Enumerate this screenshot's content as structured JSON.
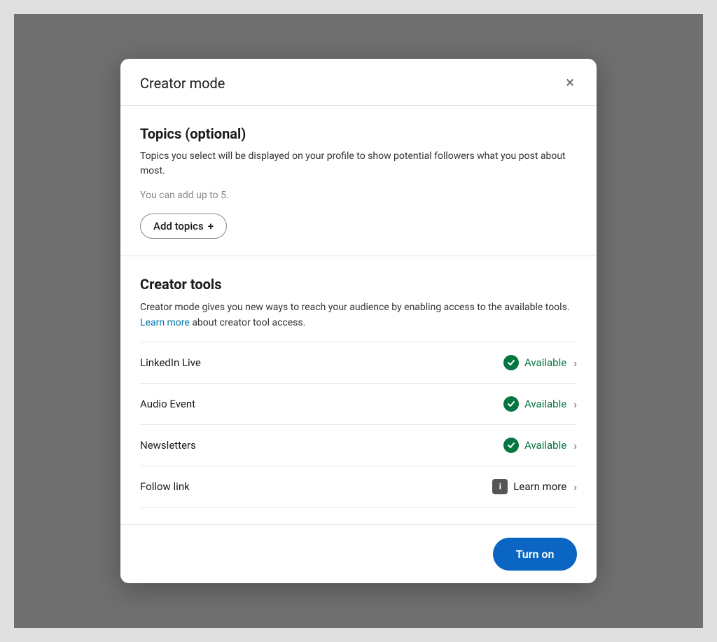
{
  "modal": {
    "title": "Creator mode",
    "close_label": "×"
  },
  "topics_section": {
    "title": "Topics (optional)",
    "description": "Topics you select will be displayed on your profile to show potential followers what you post about most.",
    "can_add_text": "You can add up to 5.",
    "add_topics_label": "Add topics",
    "add_topics_icon": "+"
  },
  "creator_tools_section": {
    "title": "Creator tools",
    "description_part1": "Creator mode gives you new ways to reach your audience by enabling access to the available tools.",
    "learn_more_label": "Learn more",
    "description_part2": "about creator tool access.",
    "tools": [
      {
        "name": "LinkedIn Live",
        "status": "available",
        "status_label": "Available",
        "icon_type": "check"
      },
      {
        "name": "Audio Event",
        "status": "available",
        "status_label": "Available",
        "icon_type": "check"
      },
      {
        "name": "Newsletters",
        "status": "available",
        "status_label": "Available",
        "icon_type": "check"
      },
      {
        "name": "Follow link",
        "status": "learn",
        "status_label": "Learn more",
        "icon_type": "info"
      }
    ]
  },
  "footer": {
    "turn_on_label": "Turn on"
  }
}
